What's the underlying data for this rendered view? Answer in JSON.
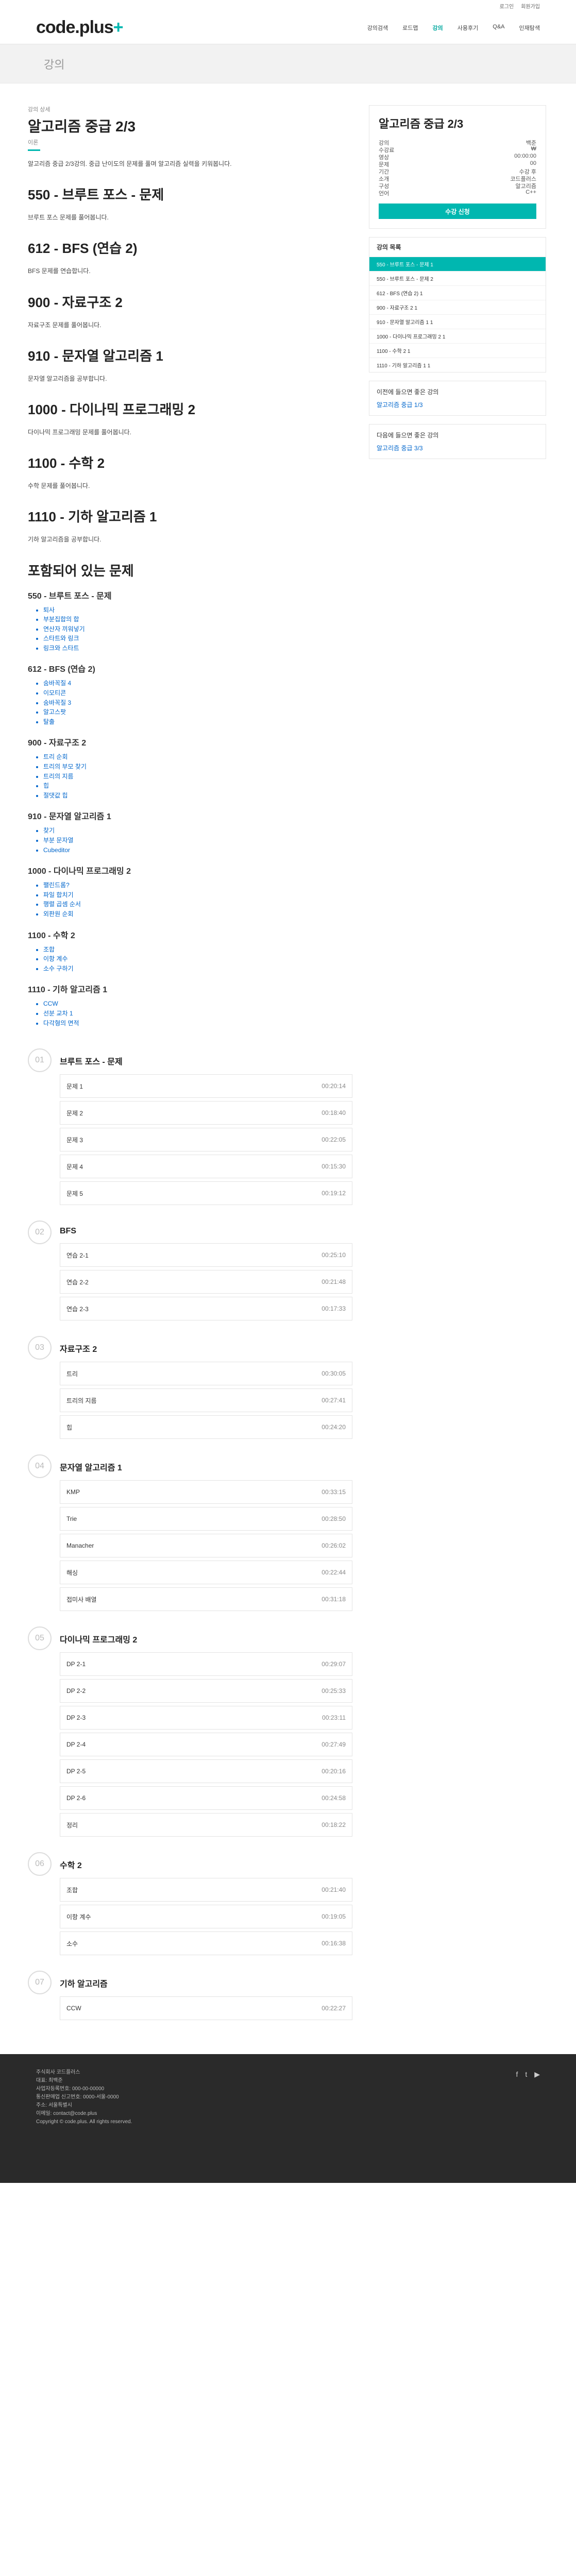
{
  "topbar": {
    "login": "로그인",
    "signup": "회원가입"
  },
  "header": {
    "logo": "code.plus",
    "logo_plus": "+",
    "nav": [
      "강의검색",
      "로드맵",
      "강의",
      "사용후기",
      "Q&A",
      "인재탐색"
    ],
    "active": 2
  },
  "section": "강의",
  "main": {
    "crumb": "강의 상세",
    "title": "알고리즘 중급 2/3",
    "title_small": "이론",
    "intro": "알고리즘 중급 2/3강의. 중급 난이도의 문제를 풀며 알고리즘 실력을 키워봅니다.",
    "topics": [
      {
        "title": "550 - 브루트 포스 - 문제",
        "desc": "브루트 포스 문제를 풀어봅니다."
      },
      {
        "title": "612 - BFS (연습 2)",
        "desc": "BFS 문제를 연습합니다."
      },
      {
        "title": "900 - 자료구조 2",
        "desc": "자료구조 문제를 풀어봅니다."
      },
      {
        "title": "910 - 문자열 알고리즘 1",
        "desc": "문자열 알고리즘을 공부합니다."
      },
      {
        "title": "1000 - 다이나믹 프로그래밍 2",
        "desc": "다이나믹 프로그래밍 문제를 풀어봅니다."
      },
      {
        "title": "1100 - 수학 2",
        "desc": "수학 문제를 풀어봅니다."
      },
      {
        "title": "1110 - 기하 알고리즘 1",
        "desc": "기하 알고리즘을 공부합니다."
      }
    ],
    "problems_head": "포함되어 있는 문제",
    "groups": [
      {
        "title": "550 - 브루트 포스 - 문제",
        "items": [
          "퇴사",
          "부분집합의 합",
          "연산자 끼워넣기",
          "스타트와 링크",
          "링크와 스타트"
        ]
      },
      {
        "title": "612 - BFS (연습 2)",
        "items": [
          "숨바꼭질 4",
          "이모티콘",
          "숨바꼭질 3",
          "알고스팟",
          "탈출"
        ]
      },
      {
        "title": "900 - 자료구조 2",
        "items": [
          "트리 순회",
          "트리의 부모 찾기",
          "트리의 지름",
          "힙",
          "절댓값 힙"
        ]
      },
      {
        "title": "910 - 문자열 알고리즘 1",
        "items": [
          "찾기",
          "부분 문자열",
          "Cubeditor"
        ]
      },
      {
        "title": "1000 - 다이나믹 프로그래밍 2",
        "items": [
          "팰린드롬?",
          "파일 합치기",
          "행렬 곱셈 순서",
          "외판원 순회"
        ]
      },
      {
        "title": "1100 - 수학 2",
        "items": [
          "조합",
          "이항 계수",
          "소수 구하기"
        ]
      },
      {
        "title": "1110 - 기하 알고리즘 1",
        "items": [
          "CCW",
          "선분 교차 1",
          "다각형의 면적"
        ]
      }
    ],
    "curriculum_head": "",
    "chapters": [
      {
        "num": "01",
        "title": "브루트 포스 - 문제",
        "rows": [
          [
            "문제 1",
            "00:20:14"
          ],
          [
            "문제 2",
            "00:18:40"
          ],
          [
            "문제 3",
            "00:22:05"
          ],
          [
            "문제 4",
            "00:15:30"
          ],
          [
            "문제 5",
            "00:19:12"
          ]
        ]
      },
      {
        "num": "02",
        "title": "BFS",
        "rows": [
          [
            "연습 2-1",
            "00:25:10"
          ],
          [
            "연습 2-2",
            "00:21:48"
          ],
          [
            "연습 2-3",
            "00:17:33"
          ]
        ]
      },
      {
        "num": "03",
        "title": "자료구조 2",
        "rows": [
          [
            "트리",
            "00:30:05"
          ],
          [
            "트리의 지름",
            "00:27:41"
          ],
          [
            "힙",
            "00:24:20"
          ]
        ]
      },
      {
        "num": "04",
        "title": "문자열 알고리즘 1",
        "rows": [
          [
            "KMP",
            "00:33:15"
          ],
          [
            "Trie",
            "00:28:50"
          ],
          [
            "Manacher",
            "00:26:02"
          ],
          [
            "해싱",
            "00:22:44"
          ],
          [
            "접미사 배열",
            "00:31:18"
          ]
        ]
      },
      {
        "num": "05",
        "title": "다이나믹 프로그래밍 2",
        "rows": [
          [
            "DP 2-1",
            "00:29:07"
          ],
          [
            "DP 2-2",
            "00:25:33"
          ],
          [
            "DP 2-3",
            "00:23:11"
          ],
          [
            "DP 2-4",
            "00:27:49"
          ],
          [
            "DP 2-5",
            "00:20:16"
          ],
          [
            "DP 2-6",
            "00:24:58"
          ],
          [
            "정리",
            "00:18:22"
          ]
        ]
      },
      {
        "num": "06",
        "title": "수학 2",
        "rows": [
          [
            "조합",
            "00:21:40"
          ],
          [
            "이항 계수",
            "00:19:05"
          ],
          [
            "소수",
            "00:16:38"
          ]
        ]
      },
      {
        "num": "07",
        "title": "기하 알고리즘",
        "rows": [
          [
            "CCW",
            "00:22:27"
          ]
        ]
      }
    ]
  },
  "side": {
    "title": "알고리즘 중급 2/3",
    "info": [
      [
        "강의",
        "백준"
      ],
      [
        "수강료",
        "₩"
      ],
      [
        "영상",
        "00:00:00"
      ],
      [
        "문제",
        "00"
      ],
      [
        "기간",
        "수강 후"
      ],
      [
        "소개",
        "코드플러스"
      ],
      [
        "구성",
        "알고리즘"
      ],
      [
        "언어",
        "C++"
      ]
    ],
    "button": "수강 신청",
    "list_head": "강의 목록",
    "lectures": [
      "550 - 브루트 포스 - 문제 1",
      "550 - 브루트 포스 - 문제 2",
      "612 - BFS (연습 2) 1",
      "900 - 자료구조 2 1",
      "910 - 문자열 알고리즘 1 1",
      "1000 - 다이나믹 프로그래밍 2 1",
      "1100 - 수학 2 1",
      "1110 - 기하 알고리즘 1 1"
    ],
    "card1": {
      "title": "이전에 들으면 좋은 강의",
      "value": "알고리즘 중급 1/3"
    },
    "card2": {
      "title": "다음에 들으면 좋은 강의",
      "value": "알고리즘 중급 3/3"
    }
  },
  "footer": {
    "lines": [
      "주식회사 코드플러스",
      "대표: 최백준",
      "사업자등록번호: 000-00-00000",
      "통신판매업 신고번호: 0000-서울-0000",
      "주소: 서울특별시",
      "이메일: contact@code.plus",
      "Copyright © code.plus. All rights reserved."
    ]
  }
}
